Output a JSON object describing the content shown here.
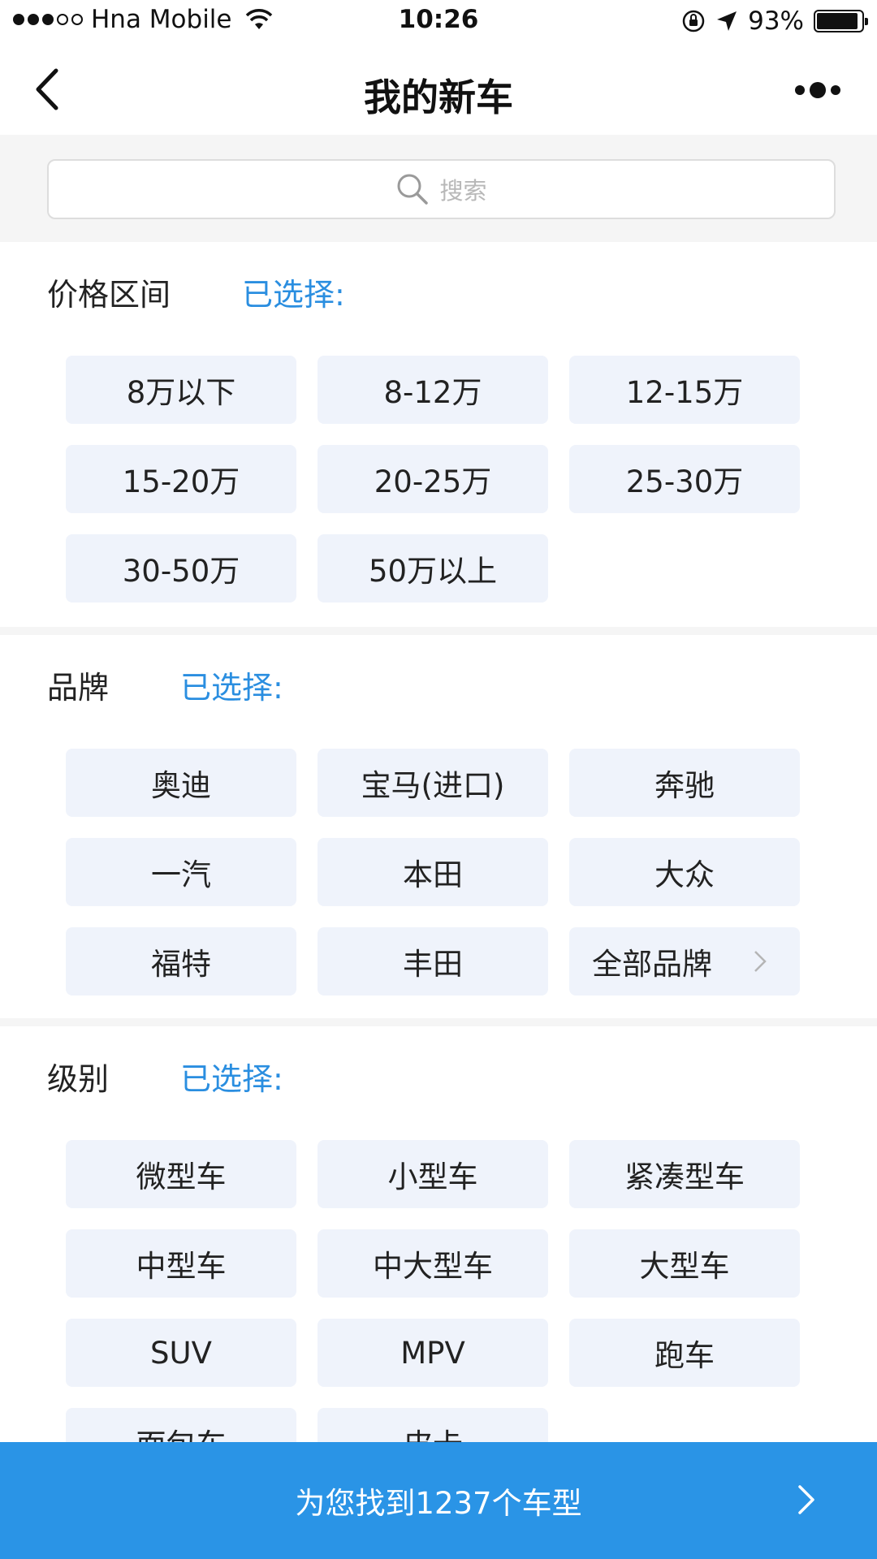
{
  "status_bar": {
    "carrier": "Hna Mobile",
    "time": "10:26",
    "battery": "93%",
    "battery_level": 0.93
  },
  "nav": {
    "title": "我的新车"
  },
  "search": {
    "placeholder": "搜索"
  },
  "price_section": {
    "title": "价格区间",
    "selected_label": "已选择:",
    "options": [
      "8万以下",
      "8-12万",
      "12-15万",
      "15-20万",
      "20-25万",
      "25-30万",
      "30-50万",
      "50万以上"
    ]
  },
  "brand_section": {
    "title": "品牌",
    "selected_label": "已选择:",
    "options": [
      "奥迪",
      "宝马(进口)",
      "奔驰",
      "一汽",
      "本田",
      "大众",
      "福特",
      "丰田"
    ],
    "all_brands_label": "全部品牌"
  },
  "level_section": {
    "title": "级别",
    "selected_label": "已选择:",
    "options": [
      "微型车",
      "小型车",
      "紧凑型车",
      "中型车",
      "中大型车",
      "大型车",
      "SUV",
      "MPV",
      "跑车",
      "面包车",
      "皮卡"
    ]
  },
  "bottom_bar": {
    "result_text": "为您找到1237个车型"
  },
  "colors": {
    "accent": "#2a94e6",
    "selected_text": "#2a8ee0",
    "chip_background": "#eff3fb"
  }
}
